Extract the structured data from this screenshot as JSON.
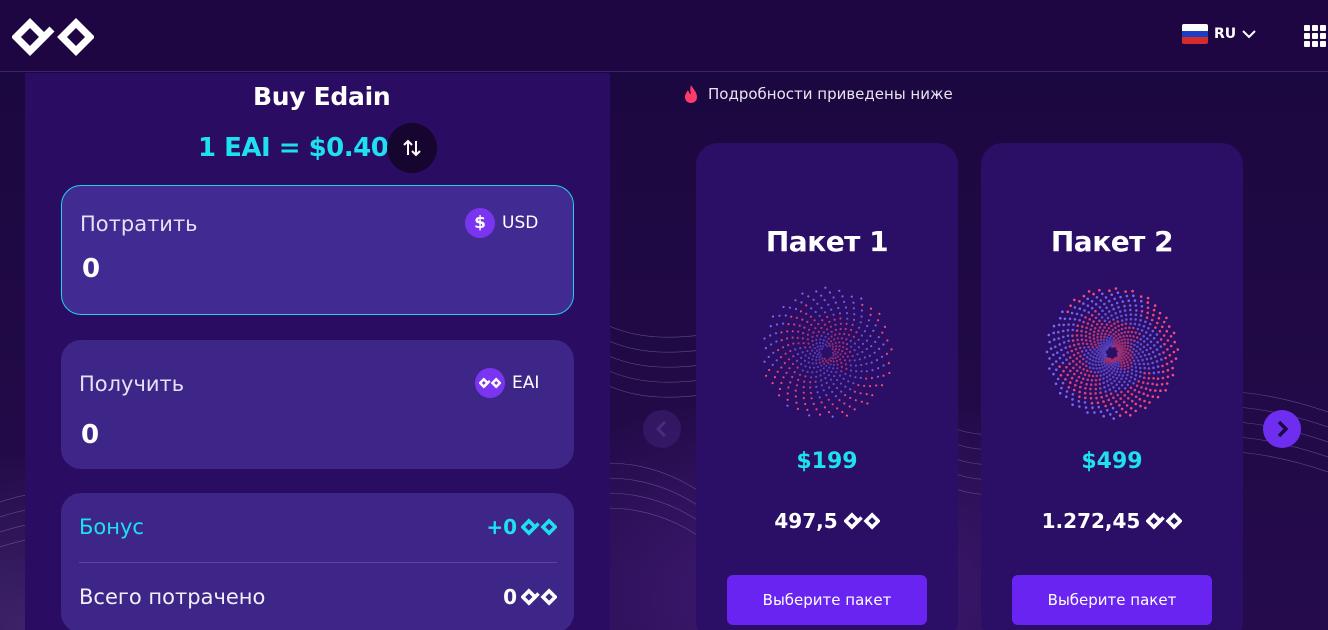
{
  "header": {
    "language": "RU"
  },
  "buy": {
    "title": "Buy Edain",
    "rate": "1 EAI = $0.40"
  },
  "spend": {
    "label": "Потратить",
    "value": "0",
    "currency": "USD",
    "currency_symbol": "$"
  },
  "receive": {
    "label": "Получить",
    "value": "0",
    "currency": "EAI"
  },
  "summary": {
    "bonus_label": "Бонус",
    "bonus_value": "+0",
    "total_label": "Всего потрачено",
    "total_value": "0"
  },
  "notice": {
    "text": "Подробности приведены ниже"
  },
  "packages": [
    {
      "title": "Пакет 1",
      "price": "$199",
      "tokens": "497,5",
      "button": "Выберите пакет"
    },
    {
      "title": "Пакет 2",
      "price": "$499",
      "tokens": "1.272,45",
      "button": "Выберите пакет"
    }
  ],
  "colors": {
    "accent_cyan": "#1ee0f0",
    "button_purple": "#6a24f2",
    "background": "#1c0840"
  },
  "icons": [
    "brand-logo-icon",
    "russia-flag-icon",
    "chevron-down-icon",
    "apps-grid-icon",
    "swap-arrows-icon",
    "dollar-coin-icon",
    "eai-coin-icon",
    "fire-icon",
    "arrow-left-icon",
    "arrow-right-icon"
  ]
}
